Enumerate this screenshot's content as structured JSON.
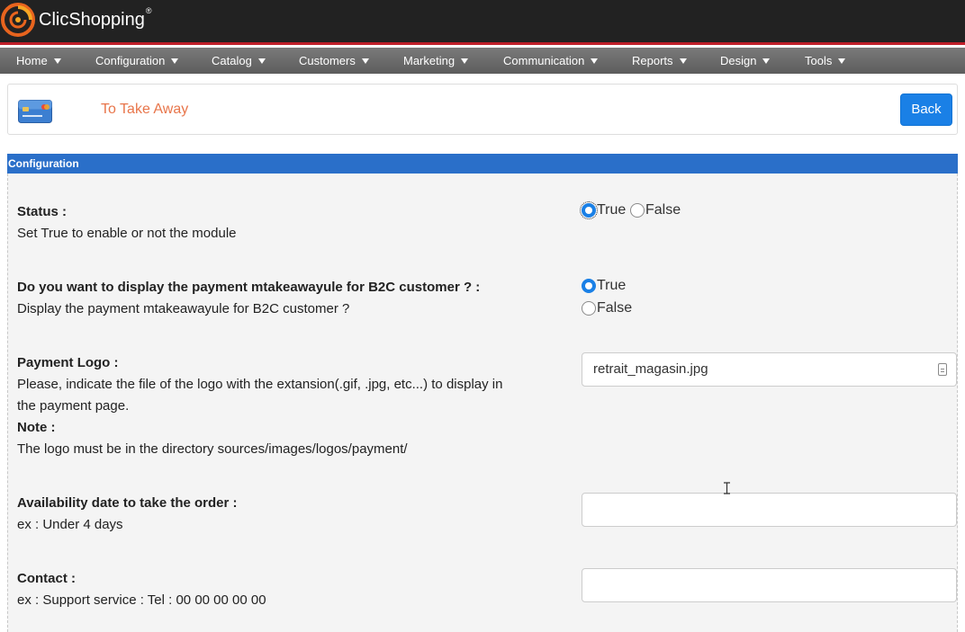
{
  "brand": {
    "name": "ClicShopping",
    "reg_mark": "®"
  },
  "nav": [
    {
      "label": "Home"
    },
    {
      "label": "Configuration"
    },
    {
      "label": "Catalog"
    },
    {
      "label": "Customers"
    },
    {
      "label": "Marketing"
    },
    {
      "label": "Communication"
    },
    {
      "label": "Reports"
    },
    {
      "label": "Design"
    },
    {
      "label": "Tools"
    }
  ],
  "header": {
    "title": "To Take Away",
    "back_label": "Back"
  },
  "section": {
    "title": "Configuration"
  },
  "rows": {
    "status": {
      "label": "Status :",
      "help": "Set True to enable or not the module",
      "options": [
        "True",
        "False"
      ],
      "selected": "True"
    },
    "b2c": {
      "label": "Do you want to display the payment mtakeawayule for B2C customer ? :",
      "help": "Display the payment mtakeawayule for B2C customer ?",
      "options": [
        "True",
        "False"
      ],
      "selected": "True"
    },
    "logo": {
      "label": "Payment Logo :",
      "help_line1": "Please, indicate the file of the logo with the extansion(.gif, .jpg, etc...) to display in",
      "help_line2": "the payment page.",
      "note_label": "Note :",
      "note_text": "The logo must be in the directory sources/images/logos/payment/",
      "value": "retrait_magasin.jpg"
    },
    "availability": {
      "label": "Availability date to take the order :",
      "help": "ex : Under 4 days",
      "value": ""
    },
    "contact": {
      "label": "Contact :",
      "help": "ex : Support service : Tel : 00 00 00 00 00",
      "value": ""
    }
  },
  "colors": {
    "topbar": "#222222",
    "accent_red": "#c0202a",
    "nav": "#6b6b6b",
    "primary_button": "#1a80e6",
    "section_bar": "#2a6fc9",
    "title_orange": "#e8754a"
  }
}
